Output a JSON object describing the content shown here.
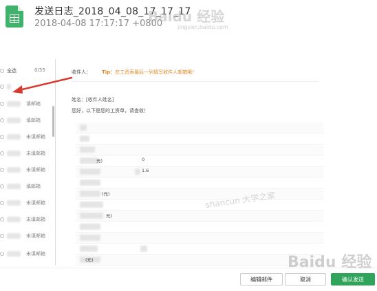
{
  "header": {
    "title": "发送日志_2018_04_08_17_17_17",
    "subtitle": "2018-04-08 17:17:17 +0800"
  },
  "watermarks": {
    "top": "Baidu 经验",
    "top_sub": "jingyan.baidu.com",
    "bottom": "Baidu 经验",
    "center": "shancun 大学之家"
  },
  "sidebar": {
    "select_all": "全选",
    "count": "0/35",
    "rows": [
      {
        "status": ""
      },
      {
        "status": "填邮箱"
      },
      {
        "status": "填邮箱"
      },
      {
        "status": "未填邮箱"
      },
      {
        "status": "未填邮箱"
      },
      {
        "status": "未填邮箱"
      },
      {
        "status": "填邮箱"
      },
      {
        "status": "未填邮箱"
      },
      {
        "status": "未填邮箱"
      },
      {
        "status": "未填邮箱"
      },
      {
        "status": "未填邮箱"
      },
      {
        "status": "未填邮箱"
      }
    ]
  },
  "main": {
    "recipient_label": "收件人：",
    "tip_label": "Tip：",
    "tip_text": "在工资表最后一列填写收件人邮箱哦！",
    "name_line": "姓名：[收件人姓名]",
    "greeting": "您好，以下是您的工资单，请查收！",
    "table_fragments": [
      "元)",
      "0",
      "1.6",
      "(元)",
      "元)",
      "(元)"
    ]
  },
  "buttons": {
    "edit": "编辑邮件",
    "cancel": "取消",
    "send": "确认发送"
  },
  "colors": {
    "accent": "#2fa45a",
    "tip": "#e08a2c",
    "arrow": "#d83a2f"
  }
}
